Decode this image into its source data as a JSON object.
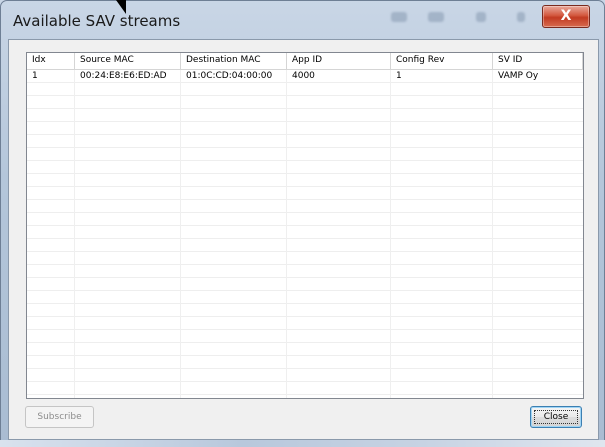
{
  "window": {
    "title": "Available SAV streams",
    "close_glyph": "X"
  },
  "table": {
    "columns": [
      "Idx",
      "Source MAC",
      "Destination MAC",
      "App ID",
      "Config Rev",
      "SV ID"
    ],
    "rows": [
      [
        "1",
        "00:24:E8:E6:ED:AD",
        "01:0C:CD:04:00:00",
        "4000",
        "1",
        "VAMP Oy"
      ]
    ]
  },
  "buttons": {
    "subscribe_label": "Subscribe",
    "close_label": "Close"
  }
}
